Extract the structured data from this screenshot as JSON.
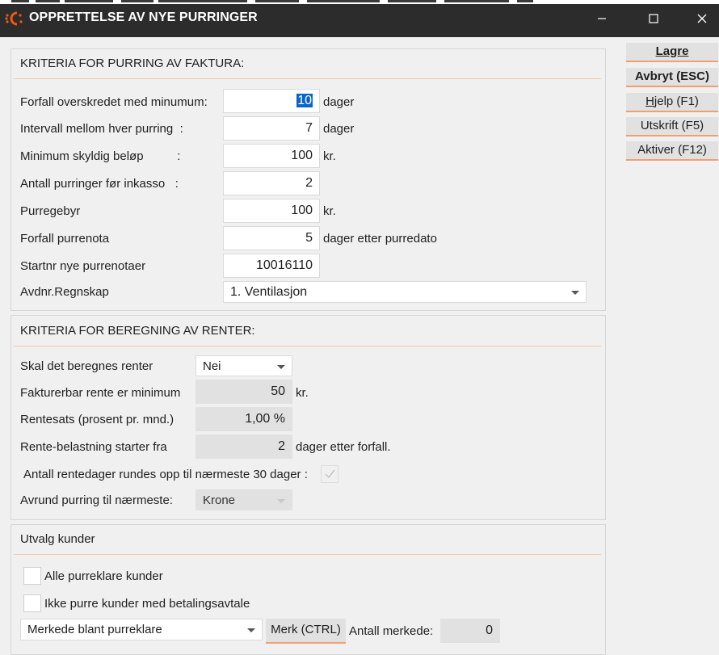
{
  "window": {
    "title": "OPPRETTELSE AV NYE PURRINGER",
    "controls": {
      "minimize": "minimize-icon",
      "maximize": "maximize-icon",
      "close": "close-icon"
    }
  },
  "actions": {
    "save": "Lagre",
    "cancel": "Avbryt (ESC)",
    "help_prefix": "H",
    "help_rest": "jelp (F1)",
    "print": "Utskrift (F5)",
    "activate": "Aktiver (F12)"
  },
  "invoice_criteria": {
    "title": "KRITERIA FOR PURRING AV FAKTURA:",
    "overdue_min": {
      "label": "Forfall overskredet med minumum:",
      "value": "10",
      "unit": "dager"
    },
    "interval": {
      "label": "Intervall mellom hver purring  :",
      "value": "7",
      "unit": "dager"
    },
    "min_amount": {
      "label": "Minimum skyldig beløp          :",
      "value": "100",
      "unit": "kr."
    },
    "count_before_collection": {
      "label": "Antall purringer før inkasso   :",
      "value": "2"
    },
    "fee": {
      "label": "Purregebyr",
      "value": "100",
      "unit": "kr."
    },
    "due_notice": {
      "label": "Forfall purrenota",
      "value": "5",
      "unit": "dager etter purredato"
    },
    "start_no": {
      "label": "Startnr nye purrenotaer",
      "value": "10016110"
    },
    "department": {
      "label": "Avdnr.Regnskap",
      "value": "1.  Ventilasjon"
    }
  },
  "interest_criteria": {
    "title": "KRITERIA FOR BEREGNING AV RENTER:",
    "calc_interest": {
      "label": "Skal det beregnes renter",
      "value": "Nei"
    },
    "min_interest": {
      "label": "Fakturerbar rente er minimum",
      "value": "50",
      "unit": "kr."
    },
    "rate": {
      "label": "Rentesats (prosent pr. mnd.)",
      "value": "1,00 %"
    },
    "start_from": {
      "label": "Rente-belastning starter fra",
      "value": "2",
      "unit": "dager etter forfall."
    },
    "round_days": {
      "label": "Antall rentedager rundes opp til nærmeste 30 dager :",
      "checked": true
    },
    "round_to": {
      "label": "Avrund purring til nærmeste:",
      "value": "Krone"
    }
  },
  "customer_selection": {
    "title": "Utvalg kunder",
    "all_customers": {
      "label": "Alle purreklare kunder",
      "checked": false
    },
    "exclude_agreement": {
      "label": "Ikke purre kunder med betalingsavtale",
      "checked": false
    },
    "filter": {
      "value": "Merkede blant purreklare"
    },
    "mark_button": "Merk (CTRL)",
    "marked_count": {
      "label": "Antall merkede:",
      "value": "0"
    }
  },
  "colors": {
    "titlebar": "#2c2c2c",
    "accent": "#f0a070",
    "selection": "#0a64c8",
    "brand_icon": "#e85a1a"
  }
}
